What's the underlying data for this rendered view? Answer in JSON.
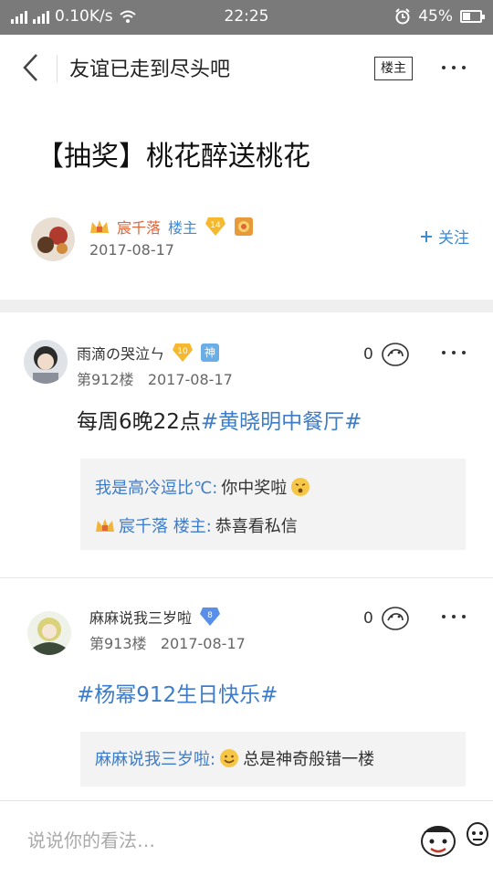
{
  "status_bar": {
    "network_speed": "0.10K/s",
    "time": "22:25",
    "battery_percent": "45%"
  },
  "header": {
    "title": "友谊已走到尽头吧",
    "only_owner_label": "楼主"
  },
  "post": {
    "title": "【抽奖】桃花醉送桃花",
    "author": {
      "name": "宸千落",
      "role": "楼主",
      "level_badge": "14",
      "date": "2017-08-17"
    },
    "follow_label": "关注"
  },
  "replies": [
    {
      "username": "雨滴の哭泣ㄣ",
      "level_badge": "10",
      "extra_badge": "神",
      "floor": "第912楼",
      "date": "2017-08-17",
      "likes": "0",
      "content_text": "每周6晚22点",
      "content_topic": "#黄晓明中餐厅#",
      "sub_replies": [
        {
          "name": "我是高冷逗比℃:",
          "text": "你中奖啦"
        },
        {
          "name": "宸千落 楼主:",
          "text": "恭喜看私信"
        }
      ]
    },
    {
      "username": "麻麻说我三岁啦",
      "level_badge": "8",
      "floor": "第913楼",
      "date": "2017-08-17",
      "likes": "0",
      "content_topic": "#杨幂912生日快乐#",
      "sub_replies": [
        {
          "name": "麻麻说我三岁啦:",
          "text": "总是神奇般错一楼"
        }
      ]
    }
  ],
  "bottom_bar": {
    "placeholder": "说说你的看法…"
  },
  "colors": {
    "accent_blue": "#3d7cc9",
    "owner_orange": "#e0663a",
    "statusbar_gray": "#7a7a7a"
  },
  "icons": [
    "back-arrow-icon",
    "more-icon",
    "crown-icon",
    "plus-icon",
    "like-hand-icon",
    "emoji-icon",
    "sticker-icon"
  ]
}
